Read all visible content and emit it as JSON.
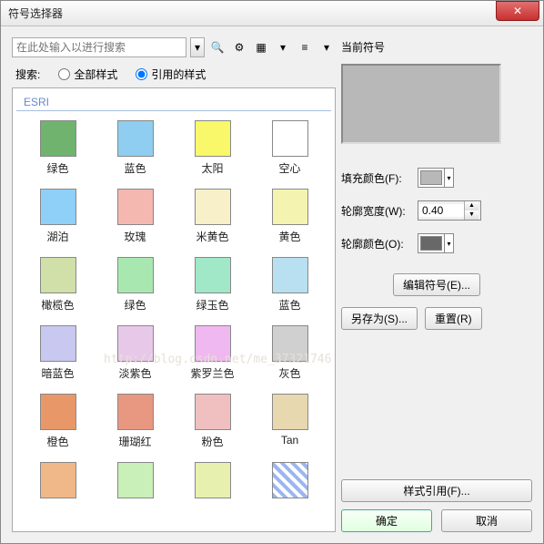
{
  "window": {
    "title": "符号选择器",
    "close": "✕"
  },
  "search": {
    "placeholder": "在此处输入以进行搜索",
    "label": "搜索:",
    "radio_all": "全部样式",
    "radio_ref": "引用的样式"
  },
  "category": "ESRI",
  "swatches": [
    {
      "label": "绿色",
      "color": "#6fb36f"
    },
    {
      "label": "蓝色",
      "color": "#8fcef0"
    },
    {
      "label": "太阳",
      "color": "#f8f86a"
    },
    {
      "label": "空心",
      "color": "#ffffff"
    },
    {
      "label": "湖泊",
      "color": "#8fd0f8"
    },
    {
      "label": "玫瑰",
      "color": "#f4b8b0"
    },
    {
      "label": "米黄色",
      "color": "#f8f0c8"
    },
    {
      "label": "黄色",
      "color": "#f4f4b0"
    },
    {
      "label": "橄榄色",
      "color": "#d0e0a8"
    },
    {
      "label": "绿色",
      "color": "#a8e8b0"
    },
    {
      "label": "绿玉色",
      "color": "#a0e8c8"
    },
    {
      "label": "蓝色",
      "color": "#b8e0f0"
    },
    {
      "label": "暗蓝色",
      "color": "#c8c8f0"
    },
    {
      "label": "淡紫色",
      "color": "#e8c8e8"
    },
    {
      "label": "紫罗兰色",
      "color": "#f0b8f0"
    },
    {
      "label": "灰色",
      "color": "#d0d0d0"
    },
    {
      "label": "橙色",
      "color": "#e89868"
    },
    {
      "label": "珊瑚红",
      "color": "#e89880"
    },
    {
      "label": "粉色",
      "color": "#f0c0c0"
    },
    {
      "label": "Tan",
      "color": "#e8d8b0"
    },
    {
      "label": "",
      "color": "#f0b888"
    },
    {
      "label": "",
      "color": "#c8f0b8"
    },
    {
      "label": "",
      "color": "#e8f0b0"
    },
    {
      "label": "",
      "color": "",
      "hatch": true
    }
  ],
  "right": {
    "current_label": "当前符号",
    "fill_label": "填充颜色(F):",
    "width_label": "轮廓宽度(W):",
    "outline_label": "轮廓颜色(O):",
    "width_value": "0.40",
    "fill_color": "#b8b8b8",
    "outline_color": "#686868",
    "edit_btn": "编辑符号(E)...",
    "saveas_btn": "另存为(S)...",
    "reset_btn": "重置(R)",
    "styleref_btn": "样式引用(F)...",
    "ok_btn": "确定",
    "cancel_btn": "取消"
  },
  "icons": {
    "zoom": "🔍",
    "puzzle": "⚙",
    "grid": "▦",
    "menu": "≡",
    "dd": "▾",
    "up": "▲",
    "down": "▼"
  }
}
